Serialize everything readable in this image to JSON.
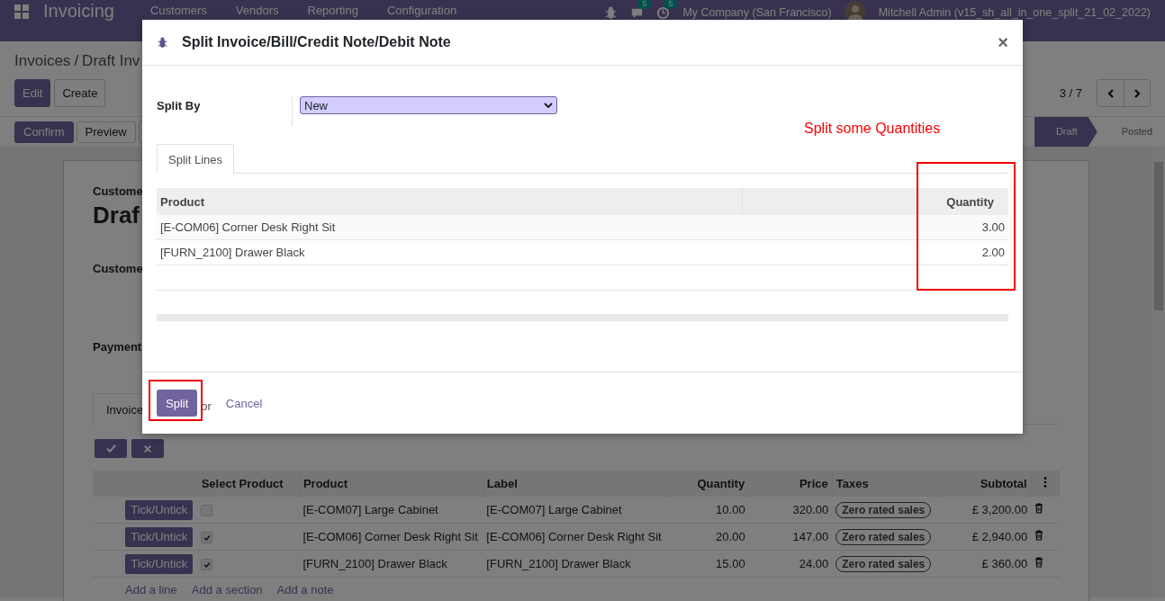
{
  "navbar": {
    "app": "Invoicing",
    "menu": [
      "Customers",
      "Vendors",
      "Reporting",
      "Configuration"
    ],
    "badges": [
      "5",
      "5"
    ],
    "company": "My Company (San Francisco)",
    "user": "Mitchell Admin (v15_sh_all_in_one_split_21_02_2022)"
  },
  "breadcrumb": [
    "Invoices",
    "Draft Inv"
  ],
  "breadcrumb_separator": "/",
  "control_buttons": [
    "Edit",
    "Create"
  ],
  "pager": "3 / 7",
  "actions": [
    "Confirm",
    "Preview"
  ],
  "statuses": [
    {
      "label": "Draft",
      "selected": true
    },
    {
      "label": "Posted",
      "selected": false
    }
  ],
  "sheet": {
    "customer_label": "Custome",
    "title": "Draf",
    "customer_field": "Custome",
    "payment_field": "Payment",
    "tab": "Invoice"
  },
  "lines": {
    "columns": [
      "Select Product",
      "Product",
      "Label",
      "Quantity",
      "Price",
      "Taxes",
      "Subtotal"
    ],
    "rows": [
      {
        "button": "Tick/Untick",
        "checked": false,
        "product": "[E-COM07] Large Cabinet",
        "label": "[E-COM07] Large Cabinet",
        "quantity": "10.00",
        "price": "320.00",
        "tax": "Zero rated sales",
        "subtotal": "£ 3,200.00"
      },
      {
        "button": "Tick/Untick",
        "checked": true,
        "product": "[E-COM06] Corner Desk Right Sit",
        "label": "[E-COM06] Corner Desk Right Sit",
        "quantity": "20.00",
        "price": "147.00",
        "tax": "Zero rated sales",
        "subtotal": "£ 2,940.00"
      },
      {
        "button": "Tick/Untick",
        "checked": true,
        "product": "[FURN_2100] Drawer Black",
        "label": "[FURN_2100] Drawer Black",
        "quantity": "15.00",
        "price": "24.00",
        "tax": "Zero rated sales",
        "subtotal": "£ 360.00"
      }
    ],
    "add_links": [
      "Add a line",
      "Add a section",
      "Add a note"
    ]
  },
  "dialog": {
    "title": "Split Invoice/Bill/Credit Note/Debit Note",
    "close": "×",
    "split_by_label": "Split By",
    "split_by_value": "New",
    "tabs": [
      {
        "label": "Split Lines",
        "selected": true
      }
    ],
    "columns": [
      "Product",
      "Quantity"
    ],
    "rows": [
      {
        "product": "[E-COM06] Corner Desk Right Sit",
        "quantity": "3.00"
      },
      {
        "product": "[FURN_2100] Drawer Black",
        "quantity": "2.00"
      }
    ],
    "split_button": "Split",
    "or": "or",
    "cancel": "Cancel",
    "note": "Split some Quantities"
  }
}
